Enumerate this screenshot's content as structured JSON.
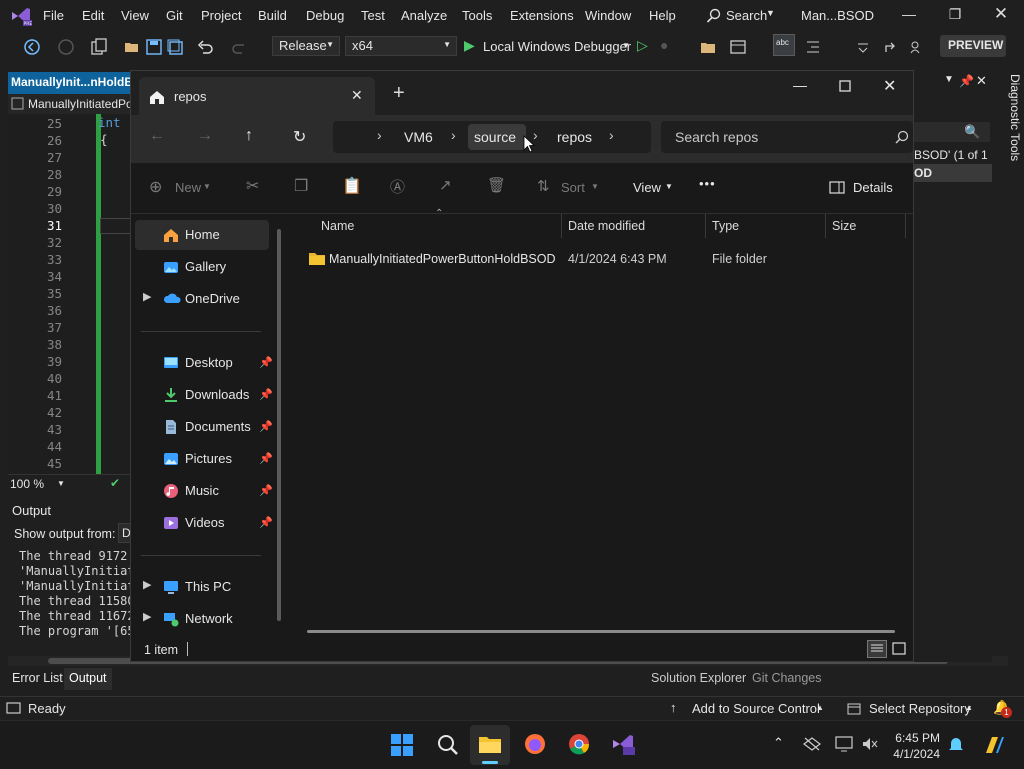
{
  "vs": {
    "menu": [
      "File",
      "Edit",
      "View",
      "Git",
      "Project",
      "Build",
      "Debug",
      "Test",
      "Analyze",
      "Tools",
      "Extensions",
      "Window",
      "Help"
    ],
    "search_label": "Search",
    "solution_name": "Man...BSOD",
    "config": "Release",
    "platform": "x64",
    "debugger": "Local Windows Debugger",
    "preview": "PREVIEW",
    "doc_tab": "ManuallyInit...nHoldB",
    "doc_nav": "ManuallyInitiatedPo",
    "line_numbers": [
      "25",
      "26",
      "27",
      "28",
      "29",
      "30",
      "31",
      "32",
      "33",
      "34",
      "35",
      "36",
      "37",
      "38",
      "39",
      "40",
      "41",
      "42",
      "43",
      "44",
      "45"
    ],
    "code_keyword": "int",
    "code_brace": "{",
    "zoom": "100 %",
    "output_title": "Output",
    "show_output_from": "Show output from:",
    "output_source": "D",
    "output_lines": [
      "The thread 9172",
      "'ManuallyInitiat",
      "'ManuallyInitiat",
      "The thread 11580",
      "The thread 11672",
      "The program '[65"
    ],
    "find_result": "BSOD' (1 of 1",
    "find_result2": "OD",
    "diagnostic_tools": "Diagnostic Tools",
    "bottom_tabs": [
      "Error List",
      "Output"
    ],
    "right_tabs": [
      "Solution Explorer",
      "Git Changes"
    ],
    "status_ready": "Ready",
    "add_source_control": "Add to Source Control",
    "select_repository": "Select Repository",
    "notification_count": "1"
  },
  "explorer": {
    "tab_title": "repos",
    "breadcrumb": [
      "VM6",
      "source",
      "repos"
    ],
    "search_placeholder": "Search repos",
    "cmd": {
      "new": "New",
      "sort": "Sort",
      "view": "View",
      "details": "Details",
      "more": "•••"
    },
    "nav": {
      "home": "Home",
      "gallery": "Gallery",
      "onedrive": "OneDrive",
      "desktop": "Desktop",
      "downloads": "Downloads",
      "documents": "Documents",
      "pictures": "Pictures",
      "music": "Music",
      "videos": "Videos",
      "thispc": "This PC",
      "network": "Network"
    },
    "columns": [
      "Name",
      "Date modified",
      "Type",
      "Size"
    ],
    "rows": [
      {
        "name": "ManuallyInitiatedPowerButtonHoldBSOD",
        "date": "4/1/2024 6:43 PM",
        "type": "File folder",
        "size": ""
      }
    ],
    "item_count": "1 item"
  },
  "taskbar": {
    "time": "6:45 PM",
    "date": "4/1/2024"
  },
  "colors": {
    "accent": "#0e639c",
    "folder": "#f4c430",
    "explorer_bg": "#191919"
  }
}
